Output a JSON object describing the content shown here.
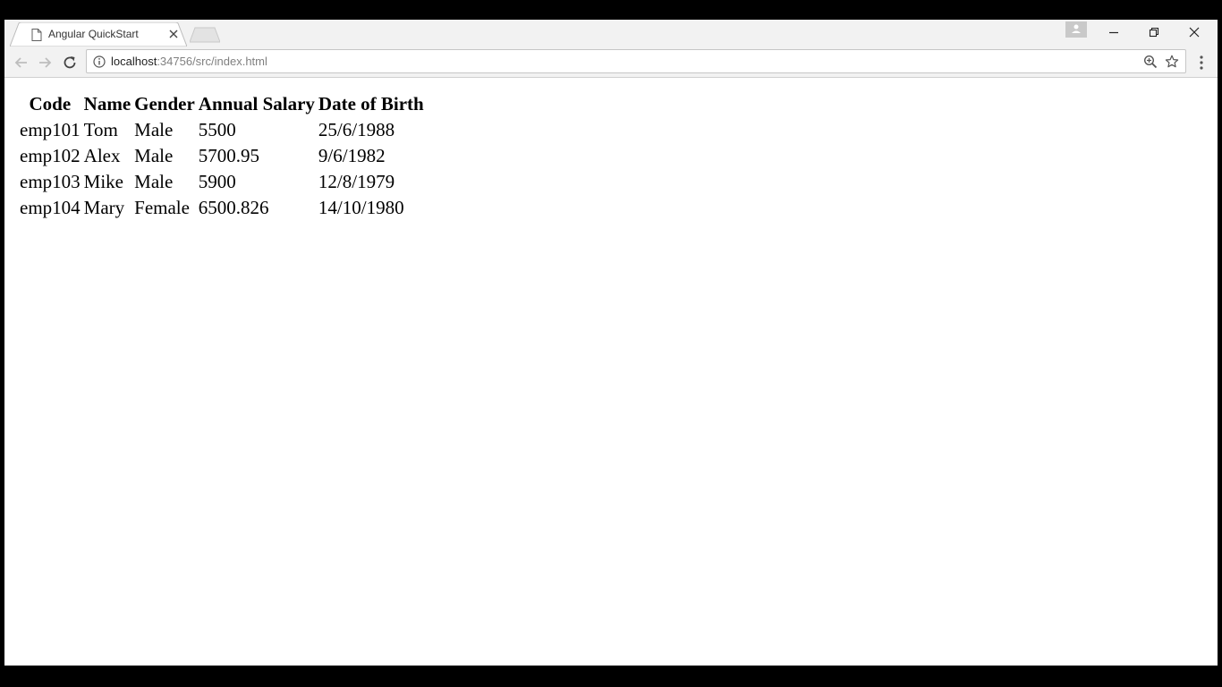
{
  "browser": {
    "tab": {
      "title": "Angular QuickStart"
    },
    "address_bar": {
      "host": "localhost",
      "rest": ":34756/src/index.html"
    },
    "icons": {
      "favicon": "page-icon",
      "tab_close": "close-icon",
      "back": "arrow-left-icon",
      "forward": "arrow-right-icon",
      "reload": "reload-icon",
      "info": "info-icon",
      "zoom": "zoom-icon",
      "bookmark": "star-icon",
      "menu": "kebab-menu-icon",
      "profile": "profile-icon",
      "minimize": "minimize-icon",
      "restore": "restore-icon",
      "close_window": "close-icon"
    }
  },
  "table": {
    "headers": [
      "Code",
      "Name",
      "Gender",
      "Annual Salary",
      "Date of Birth"
    ],
    "rows": [
      [
        "emp101",
        "Tom",
        "Male",
        "5500",
        "25/6/1988"
      ],
      [
        "emp102",
        "Alex",
        "Male",
        "5700.95",
        "9/6/1982"
      ],
      [
        "emp103",
        "Mike",
        "Male",
        "5900",
        "12/8/1979"
      ],
      [
        "emp104",
        "Mary",
        "Female",
        "6500.826",
        "14/10/1980"
      ]
    ]
  }
}
